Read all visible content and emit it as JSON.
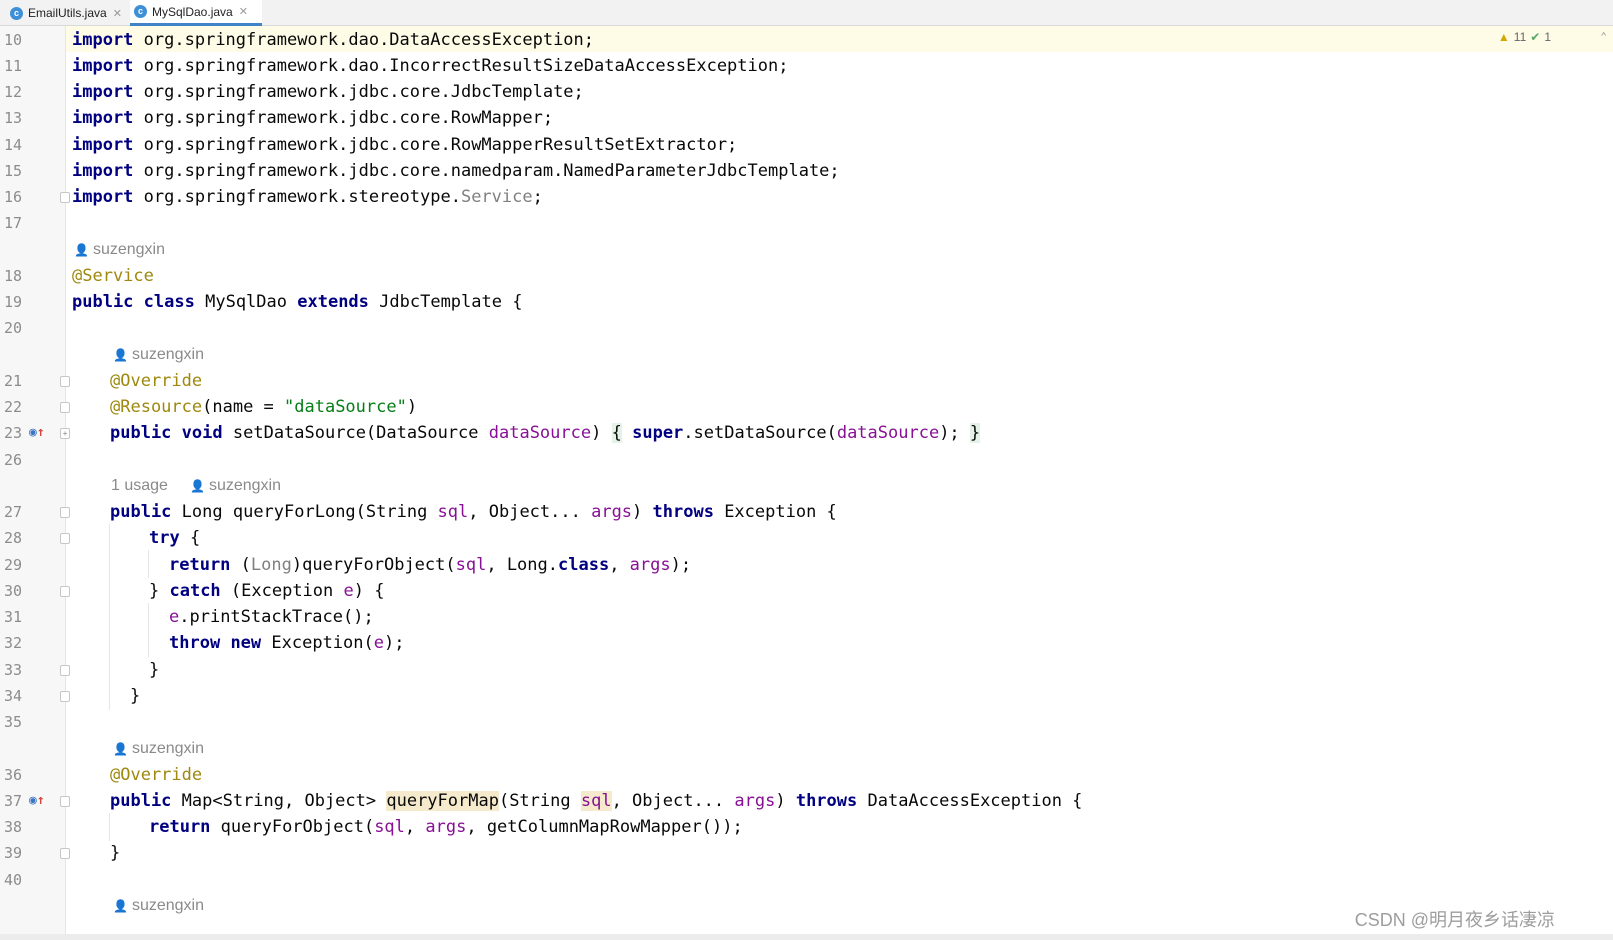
{
  "tabs": [
    {
      "label": "EmailUtils.java",
      "icon": "c-class-icon"
    },
    {
      "label": "MySqlDao.java",
      "icon": "c-class-icon",
      "active": true
    }
  ],
  "inspections": {
    "warnings": "11",
    "weak_warnings": "1"
  },
  "line_numbers": [
    "10",
    "11",
    "12",
    "13",
    "14",
    "15",
    "16",
    "17",
    "18",
    "19",
    "20",
    "21",
    "22",
    "23",
    "26",
    "27",
    "28",
    "29",
    "30",
    "31",
    "32",
    "33",
    "34",
    "35",
    "36",
    "37",
    "38",
    "39",
    "40"
  ],
  "imports": [
    "org.springframework.dao.DataAccessException;",
    "org.springframework.dao.IncorrectResultSizeDataAccessException;",
    "org.springframework.jdbc.core.JdbcTemplate;",
    "org.springframework.jdbc.core.RowMapper;",
    "org.springframework.jdbc.core.RowMapperResultSetExtractor;",
    "org.springframework.jdbc.core.namedparam.NamedParameterJdbcTemplate;"
  ],
  "last_import_prefix": "org.springframework.stereotype.",
  "last_import_class": "Service",
  "keyword_import": "import",
  "author": "suzengxin",
  "usage_hint": "1 usage",
  "code": {
    "service_annotation": "@Service",
    "class_decl_public": "public",
    "class_decl_class": "class",
    "class_name": "MySqlDao",
    "class_extends": "extends",
    "class_parent": "JdbcTemplate {",
    "override": "@Override",
    "resource_ann": "@Resource",
    "resource_args_pre": "(name = ",
    "resource_value": "\"dataSource\"",
    "resource_args_post": ")",
    "set_ds_public": "public",
    "set_ds_void": "void",
    "set_ds_sig": "setDataSource(DataSource ",
    "set_ds_param": "dataSource",
    "set_ds_close": ")",
    "set_ds_open_brace": "{",
    "set_ds_super": "super",
    "set_ds_call": ".setDataSource(",
    "set_ds_arg": "dataSource",
    "set_ds_end": ");",
    "set_ds_close_brace": "}",
    "qfl_public": "public",
    "qfl_sig_pre": "Long queryForLong(String ",
    "qfl_sql": "sql",
    "qfl_mid": ", Object... ",
    "qfl_args": "args",
    "qfl_close": ") ",
    "qfl_throws": "throws",
    "qfl_exc": " Exception {",
    "try_kw": "try",
    "try_rest": " {",
    "return_kw": "return",
    "ret_cast_open": " (",
    "ret_cast_type": "Long",
    "ret_call": ")queryForObject(",
    "ret_sql": "sql",
    "ret_mid": ", Long.",
    "ret_class_kw": "class",
    "ret_comma": ", ",
    "ret_args": "args",
    "ret_end": ");",
    "catch_pre": "} ",
    "catch_kw": "catch",
    "catch_mid": " (Exception ",
    "catch_var": "e",
    "catch_end": ") {",
    "print_var": "e",
    "print_call": ".printStackTrace();",
    "throw_kw": "throw",
    "new_kw": "new",
    "throw_rest_pre": " Exception(",
    "throw_var": "e",
    "throw_end": ");",
    "close_brace": "}",
    "qfm_public": "public",
    "qfm_ret": " Map<String, Object> ",
    "qfm_name": "queryForMap",
    "qfm_open": "(String ",
    "qfm_sql": "sql",
    "qfm_mid": ", Object... ",
    "qfm_args": "args",
    "qfm_close": ") ",
    "qfm_throws": "throws",
    "qfm_exc": " DataAccessException {",
    "qfm_return": "return",
    "qfm_call": " queryForObject(",
    "qfm_sql2": "sql",
    "qfm_comma": ", ",
    "qfm_args2": "args",
    "qfm_end": ", getColumnMapRowMapper());"
  },
  "watermark": "CSDN @明月夜乡话凄凉"
}
